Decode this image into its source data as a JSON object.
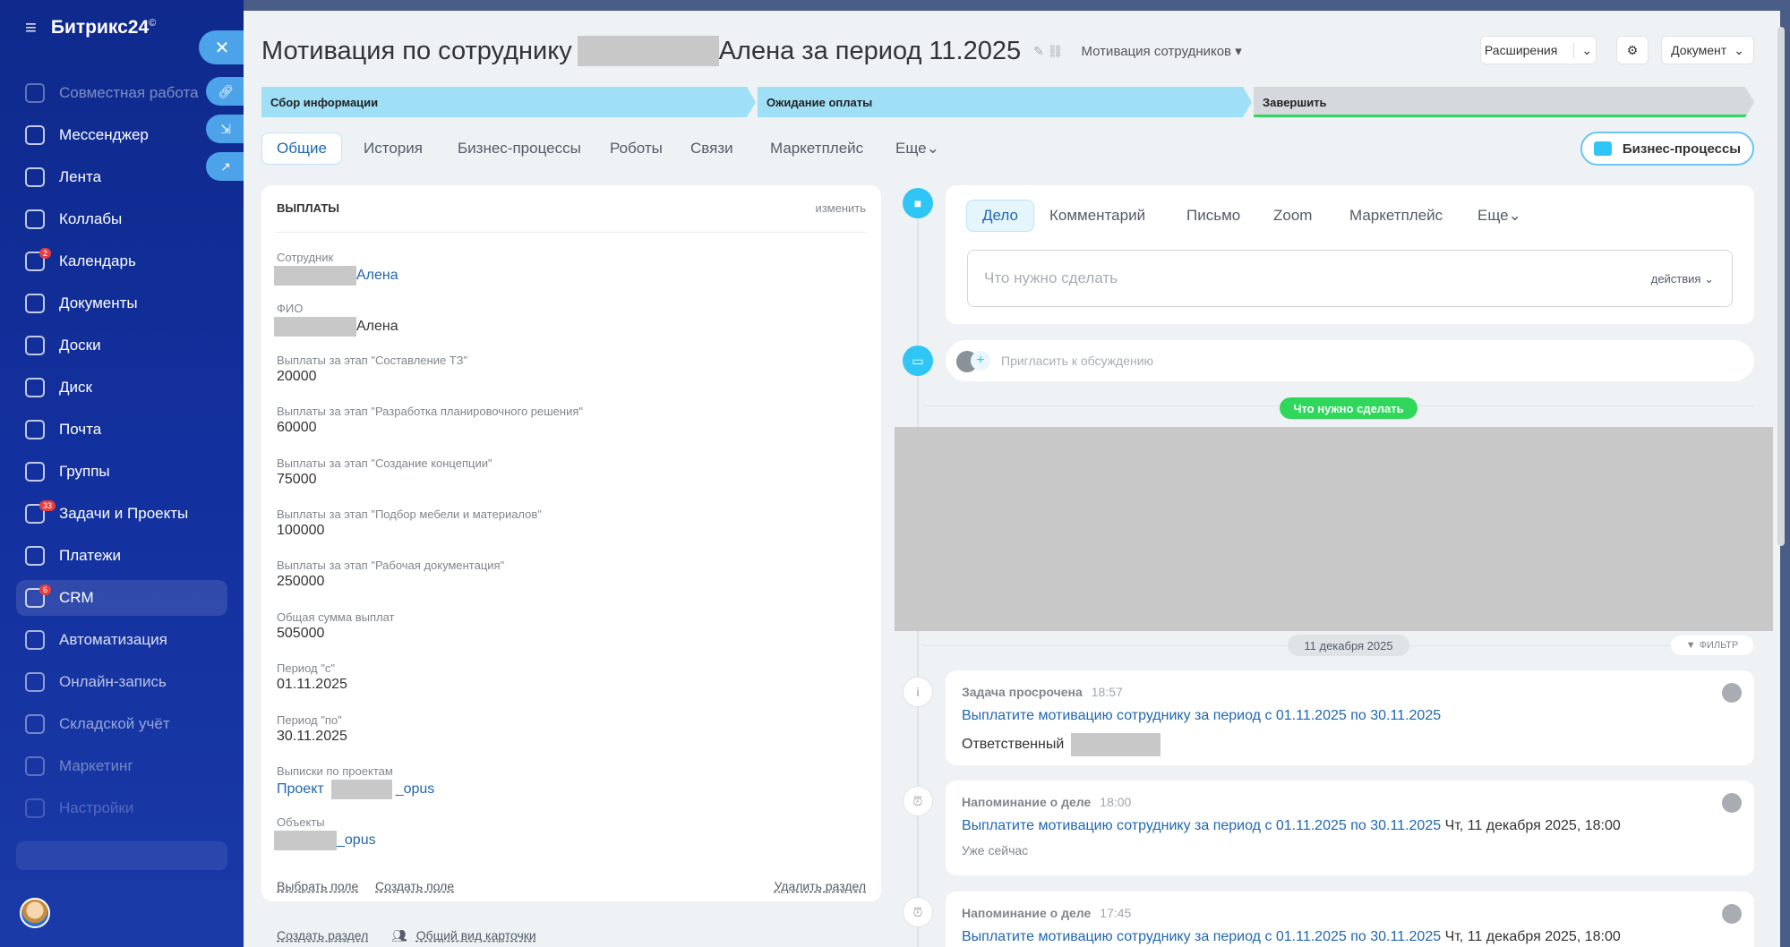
{
  "app": {
    "name": "Битрикс24",
    "mark": "©"
  },
  "nav": {
    "items": [
      {
        "label": "Совместная работа",
        "dim": true
      },
      {
        "label": "Мессенджер"
      },
      {
        "label": "Лента"
      },
      {
        "label": "Коллабы"
      },
      {
        "label": "Календарь",
        "badge": "2"
      },
      {
        "label": "Документы"
      },
      {
        "label": "Доски"
      },
      {
        "label": "Диск"
      },
      {
        "label": "Почта"
      },
      {
        "label": "Группы"
      },
      {
        "label": "Задачи и Проекты",
        "badge": "33"
      },
      {
        "label": "Платежи"
      },
      {
        "label": "CRM",
        "badge": "6",
        "active": true
      },
      {
        "label": "Автоматизация"
      },
      {
        "label": "Онлайн-запись"
      },
      {
        "label": "Складской учёт"
      },
      {
        "label": "Маркетинг"
      },
      {
        "label": "Настройки"
      }
    ]
  },
  "header": {
    "title_prefix": "Мотивация по сотруднику",
    "title_suffix": "Алена за период 11.2025",
    "category": "Мотивация сотрудников",
    "extensions_label": "Расширения",
    "document_label": "Документ"
  },
  "stages": [
    {
      "label": "Сбор информации",
      "color": "#9fe0f7"
    },
    {
      "label": "Ожидание оплаты",
      "color": "#9fe0f7"
    },
    {
      "label": "Завершить",
      "color": "#d5d8dc",
      "underline": "#2fd75b"
    }
  ],
  "tabs": [
    "Общие",
    "История",
    "Бизнес-процессы",
    "Роботы",
    "Связи",
    "Маркетплейс",
    "Еще"
  ],
  "bp_button": "Бизнес-процессы",
  "card": {
    "title": "ВЫПЛАТЫ",
    "edit": "изменить",
    "fields": [
      {
        "label": "Сотрудник",
        "value": "Алена",
        "link": true,
        "redact": true
      },
      {
        "label": "ФИО",
        "value": "Алена",
        "redact": true
      },
      {
        "label": "Выплаты за этап \"Составление ТЗ\"",
        "value": "20000"
      },
      {
        "label": "Выплаты за этап \"Разработка планировочного решения\"",
        "value": "60000"
      },
      {
        "label": "Выплаты за этап \"Создание концепции\"",
        "value": "75000"
      },
      {
        "label": "Выплаты за этап \"Подбор мебели и материалов\"",
        "value": "100000"
      },
      {
        "label": "Выплаты за этап \"Рабочая документация\"",
        "value": "250000"
      },
      {
        "label": "Общая сумма выплат",
        "value": "505000"
      },
      {
        "label": "Период \"с\"",
        "value": "01.11.2025"
      },
      {
        "label": "Период \"по\"",
        "value": "30.11.2025"
      },
      {
        "label": "Выписки по проектам",
        "value": "Проект",
        "value2": "_opus",
        "link": true,
        "redact_mid": true
      },
      {
        "label": "Объекты",
        "value": "_opus",
        "link": true,
        "redact": true
      }
    ],
    "choose_field": "Выбрать поле",
    "create_field": "Создать поле",
    "delete_section": "Удалить раздел"
  },
  "below_card": {
    "create_section": "Создать раздел",
    "card_view": "Общий вид карточки"
  },
  "editor": {
    "tabs": [
      "Дело",
      "Комментарий",
      "Письмо",
      "Zoom",
      "Маркетплейс",
      "Еще"
    ],
    "placeholder": "Что нужно сделать",
    "actions": "действия"
  },
  "invite_placeholder": "Пригласить к обсуждению",
  "todo_pill": "Что нужно сделать",
  "date_pill": "11 декабря 2025",
  "filter_label": "ФИЛЬТР",
  "timeline": [
    {
      "title": "Задача просрочена",
      "time": "18:57",
      "link": "Выплатите мотивацию сотруднику за период с 01.11.2025 по 30.11.2025",
      "extra_label": "Ответственный"
    },
    {
      "title": "Напоминание о деле",
      "time": "18:00",
      "link": "Выплатите мотивацию сотруднику за период с 01.11.2025 по 30.11.2025",
      "date": "Чт, 11 декабря 2025, 18:00",
      "note": "Уже сейчас"
    },
    {
      "title": "Напоминание о деле",
      "time": "17:45",
      "link": "Выплатите мотивацию сотруднику за период с 01.11.2025 по 30.11.2025",
      "date": "Чт, 11 декабря 2025, 18:00"
    }
  ],
  "colors": {
    "accent": "#2fc6f6",
    "link": "#2067b0",
    "success": "#2fd75b",
    "nav": "#12309e"
  }
}
